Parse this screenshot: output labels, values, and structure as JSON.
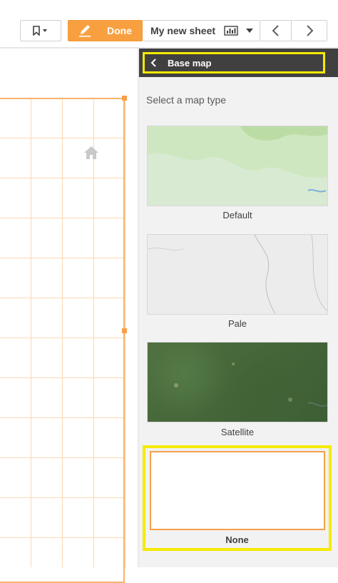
{
  "toolbar": {
    "done_label": "Done",
    "sheet_title": "My new sheet"
  },
  "panel": {
    "back_label": "Base map",
    "subtitle": "Select a map type",
    "map_types": [
      {
        "label": "Default"
      },
      {
        "label": "Pale"
      },
      {
        "label": "Satellite"
      },
      {
        "label": "None",
        "selected": true
      }
    ]
  },
  "colors": {
    "accent_orange": "#f8a040",
    "highlight_yellow": "#f5ea00",
    "panel_header": "#404040"
  },
  "icons": [
    "bookmark-icon",
    "pencil-icon",
    "sheet-chart-icon",
    "chevron-left-icon",
    "chevron-right-icon",
    "home-icon"
  ]
}
